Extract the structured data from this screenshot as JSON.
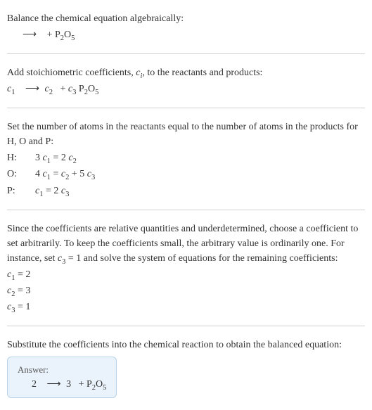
{
  "s1": {
    "intro": "Balance the chemical equation algebraically:",
    "eq_arrow": "⟶",
    "eq_plus": "+ P",
    "eq_p2": "2",
    "eq_o": "O",
    "eq_o5": "5"
  },
  "s2": {
    "intro_a": "Add stoichiometric coefficients, ",
    "ci_c": "c",
    "ci_i": "i",
    "intro_b": ", to the reactants and products:",
    "c1": "c",
    "c1s": "1",
    "arrow": "⟶",
    "c2": "c",
    "c2s": "2",
    "plus": " + ",
    "c3": "c",
    "c3s": "3",
    "sp": " P",
    "p2": "2",
    "o": "O",
    "o5": "5"
  },
  "s3": {
    "intro": "Set the number of atoms in the reactants equal to the number of atoms in the products for H, O and P:",
    "rows": [
      {
        "el": "H:",
        "lhs_coef": "3 ",
        "lhs_c": "c",
        "lhs_s": "1",
        "eq": " = ",
        "r1_coef": "2 ",
        "r1_c": "c",
        "r1_s": "2",
        "plus": "",
        "r2_coef": "",
        "r2_c": "",
        "r2_s": ""
      },
      {
        "el": "O:",
        "lhs_coef": "4 ",
        "lhs_c": "c",
        "lhs_s": "1",
        "eq": " = ",
        "r1_coef": "",
        "r1_c": "c",
        "r1_s": "2",
        "plus": " + ",
        "r2_coef": "5 ",
        "r2_c": "c",
        "r2_s": "3"
      },
      {
        "el": "P:",
        "lhs_coef": "",
        "lhs_c": "c",
        "lhs_s": "1",
        "eq": " = ",
        "r1_coef": "2 ",
        "r1_c": "c",
        "r1_s": "3",
        "plus": "",
        "r2_coef": "",
        "r2_c": "",
        "r2_s": ""
      }
    ]
  },
  "s4": {
    "intro_a": "Since the coefficients are relative quantities and underdetermined, choose a coefficient to set arbitrarily. To keep the coefficients small, the arbitrary value is ordinarily one. For instance, set ",
    "c3": "c",
    "c3s": "3",
    "intro_b": " = 1 and solve the system of equations for the remaining coefficients:",
    "rows": [
      {
        "c": "c",
        "s": "1",
        "eq": " = 2"
      },
      {
        "c": "c",
        "s": "2",
        "eq": " = 3"
      },
      {
        "c": "c",
        "s": "3",
        "eq": " = 1"
      }
    ]
  },
  "s5": {
    "intro": "Substitute the coefficients into the chemical reaction to obtain the balanced equation:",
    "answer_label": "Answer:",
    "a_2": "2 ",
    "arrow": "⟶",
    "a_3": " 3 ",
    "plus": " + P",
    "p2": "2",
    "o": "O",
    "o5": "5"
  }
}
